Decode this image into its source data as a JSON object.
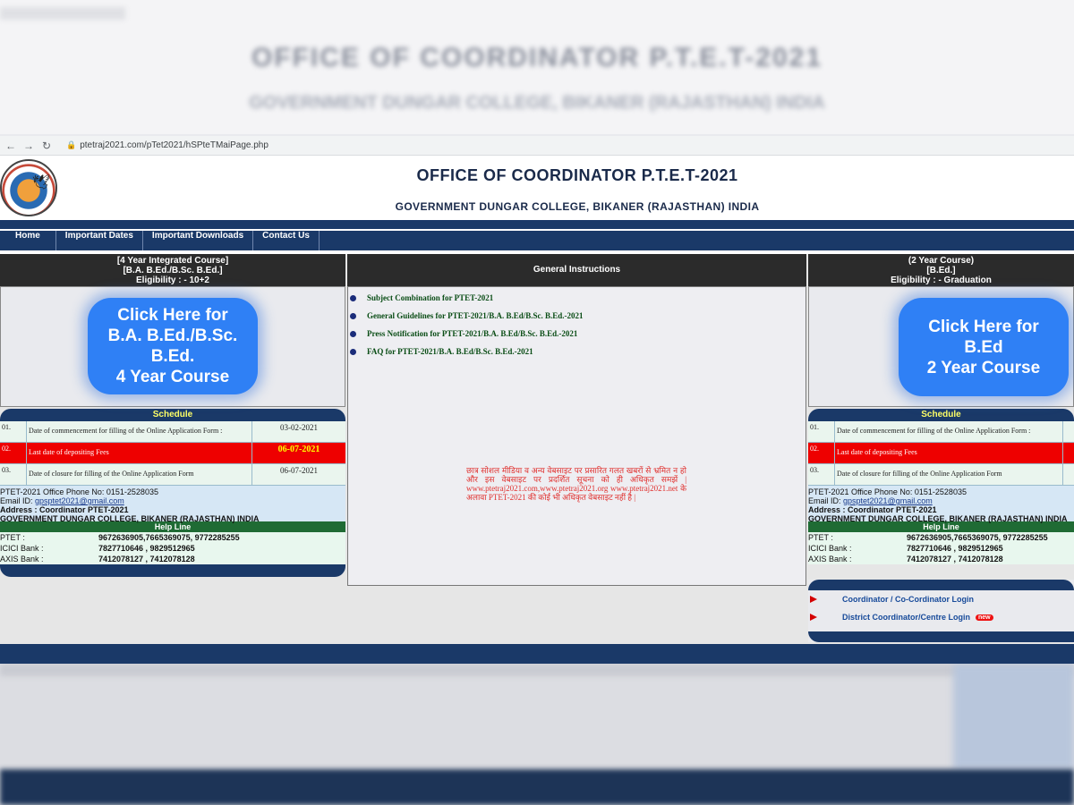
{
  "browser": {
    "url": "ptetraj2021.com/pTet2021/hSPteTMaiPage.php"
  },
  "header": {
    "title": "OFFICE OF COORDINATOR P.T.E.T-2021",
    "subtitle": "GOVERNMENT DUNGAR COLLEGE, BIKANER (RAJASTHAN) INDIA"
  },
  "nav": [
    "Home",
    "Important Dates",
    "Important Downloads",
    "Contact Us"
  ],
  "left": {
    "course": "[4 Year Integrated Course]",
    "degree": "[B.A. B.Ed./B.Sc. B.Ed.]",
    "eligibility": "Eligibility : - 10+2",
    "button": "Click Here for\nB.A. B.Ed./B.Sc.\nB.Ed.\n4 Year Course"
  },
  "right": {
    "course": "(2 Year Course)",
    "degree": "[B.Ed.]",
    "eligibility": "Eligibility : - Graduation",
    "button": "Click Here for\nB.Ed\n2 Year Course"
  },
  "schedule": {
    "title": "Schedule",
    "rows": [
      {
        "num": "01.",
        "desc": "Date of commencement for filling of the Online Application Form :",
        "date": "03-02-2021"
      },
      {
        "num": "02.",
        "desc": "Last date of depositing Fees",
        "date": "06-07-2021"
      },
      {
        "num": "03.",
        "desc": "Date of closure for filling of the Online Application Form",
        "date": "06-07-2021"
      }
    ]
  },
  "contact": {
    "phone": "PTET-2021 Office Phone No: 0151-2528035",
    "email_label": "Email ID: ",
    "email": "gpsptet2021@gmail.com",
    "address": "Address : Coordinator PTET-2021",
    "college": "GOVERNMENT DUNGAR COLLEGE, BIKANER (RAJASTHAN) INDIA"
  },
  "helpline": {
    "title": "Help Line",
    "rows": [
      {
        "label": "PTET :",
        "value": "9672636905,7665369075, 9772285255"
      },
      {
        "label": "ICICI Bank :",
        "value": "7827710646 , 9829512965"
      },
      {
        "label": "AXIS Bank :",
        "value": "7412078127 , 7412078128"
      }
    ]
  },
  "instructions": {
    "title": "General Instructions",
    "items": [
      "Subject Combination for PTET-2021",
      "General Guidelines for PTET-2021/B.A. B.Ed/B.Sc. B.Ed.-2021",
      "Press Notification for PTET-2021/B.A. B.Ed/B.Sc. B.Ed.-2021",
      "FAQ for PTET-2021/B.A. B.Ed/B.Sc. B.Ed.-2021"
    ],
    "notice": "छात्र सोशल मीडिया व अन्य वेबसाइट पर प्रसारित गलत खबरों से भ्रमित न हो और इस वेबसाइट पर प्रदर्शित सूचना को ही अधिकृत समझें | www.ptetraj2021.com,www.ptetraj2021.org www.ptetraj2021.net के अलावा PTET-2021 की कोई भी अधिकृत वेबसाइट नहीं है |"
  },
  "login": {
    "items": [
      "Coordinator / Co-Cordinator Login",
      "District Coordinator/Centre Login"
    ],
    "new_badge": "new"
  },
  "backdrop": {
    "title": "OFFICE OF COORDINATOR P.T.E.T-2021",
    "subtitle": "GOVERNMENT DUNGAR COLLEGE, BIKANER (RAJASTHAN) INDIA"
  },
  "colors": {
    "navy": "#1a3968",
    "button": "#2f80f5",
    "alert": "#ee0000",
    "helpline": "#1f6b34"
  }
}
